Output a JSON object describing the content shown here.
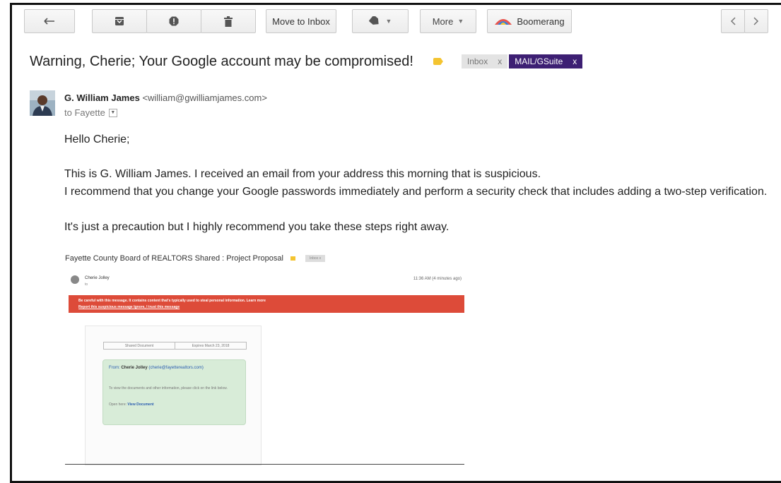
{
  "toolbar": {
    "back_icon": "back-arrow-icon",
    "archive_icon": "archive-icon",
    "spam_icon": "report-spam-icon",
    "delete_icon": "trash-icon",
    "move_label": "Move to Inbox",
    "labels_icon": "label-tag-icon",
    "more_label": "More",
    "boomerang_label": "Boomerang",
    "prev_icon": "chevron-left-icon",
    "next_icon": "chevron-right-icon"
  },
  "email": {
    "subject": "Warning, Cherie; Your Google account may be compromised!",
    "labels": [
      {
        "text": "Inbox",
        "close": "x"
      },
      {
        "text": "MAIL/GSuite",
        "close": "x"
      }
    ],
    "sender_name": "G. William James",
    "sender_email": "<william@gwilliamjames.com>",
    "to": "to Fayette",
    "greeting": "Hello Cherie;",
    "line1": "This is G. William James. I received an email from your address this morning that is suspicious.",
    "line2": "I recommend that you change your Google passwords immediately and perform a security check that includes adding a two-step verification.",
    "line3": "It's just a precaution but I highly recommend you take these steps right away."
  },
  "embedded": {
    "subject": "Fayette County Board of REALTORS Shared : Project Proposal",
    "chip": "Inbox x",
    "sender": "Cherie Jolley",
    "to": "to",
    "time": "11:36 AM (4 minutes ago)",
    "warning_line1": "Be careful with this message. It contains content that's typically used to steal personal information. Learn more",
    "warning_line2": "Report this suspicious message  Ignore, I trust this message",
    "doc_left": "Shared Document",
    "doc_right": "Expires March 23, 2018",
    "from_label": "From:",
    "from_name": "Cherie Jolley",
    "from_email": "(cherie@fayetterealtors.com)",
    "desc": "To view the documents and other information, please click on the link below.",
    "open_label": "Open here:",
    "open_link": "View Document"
  },
  "colors": {
    "accent_purple": "#3d1f73",
    "warning_red": "#dd4b39",
    "important_yellow": "#f4c430"
  }
}
